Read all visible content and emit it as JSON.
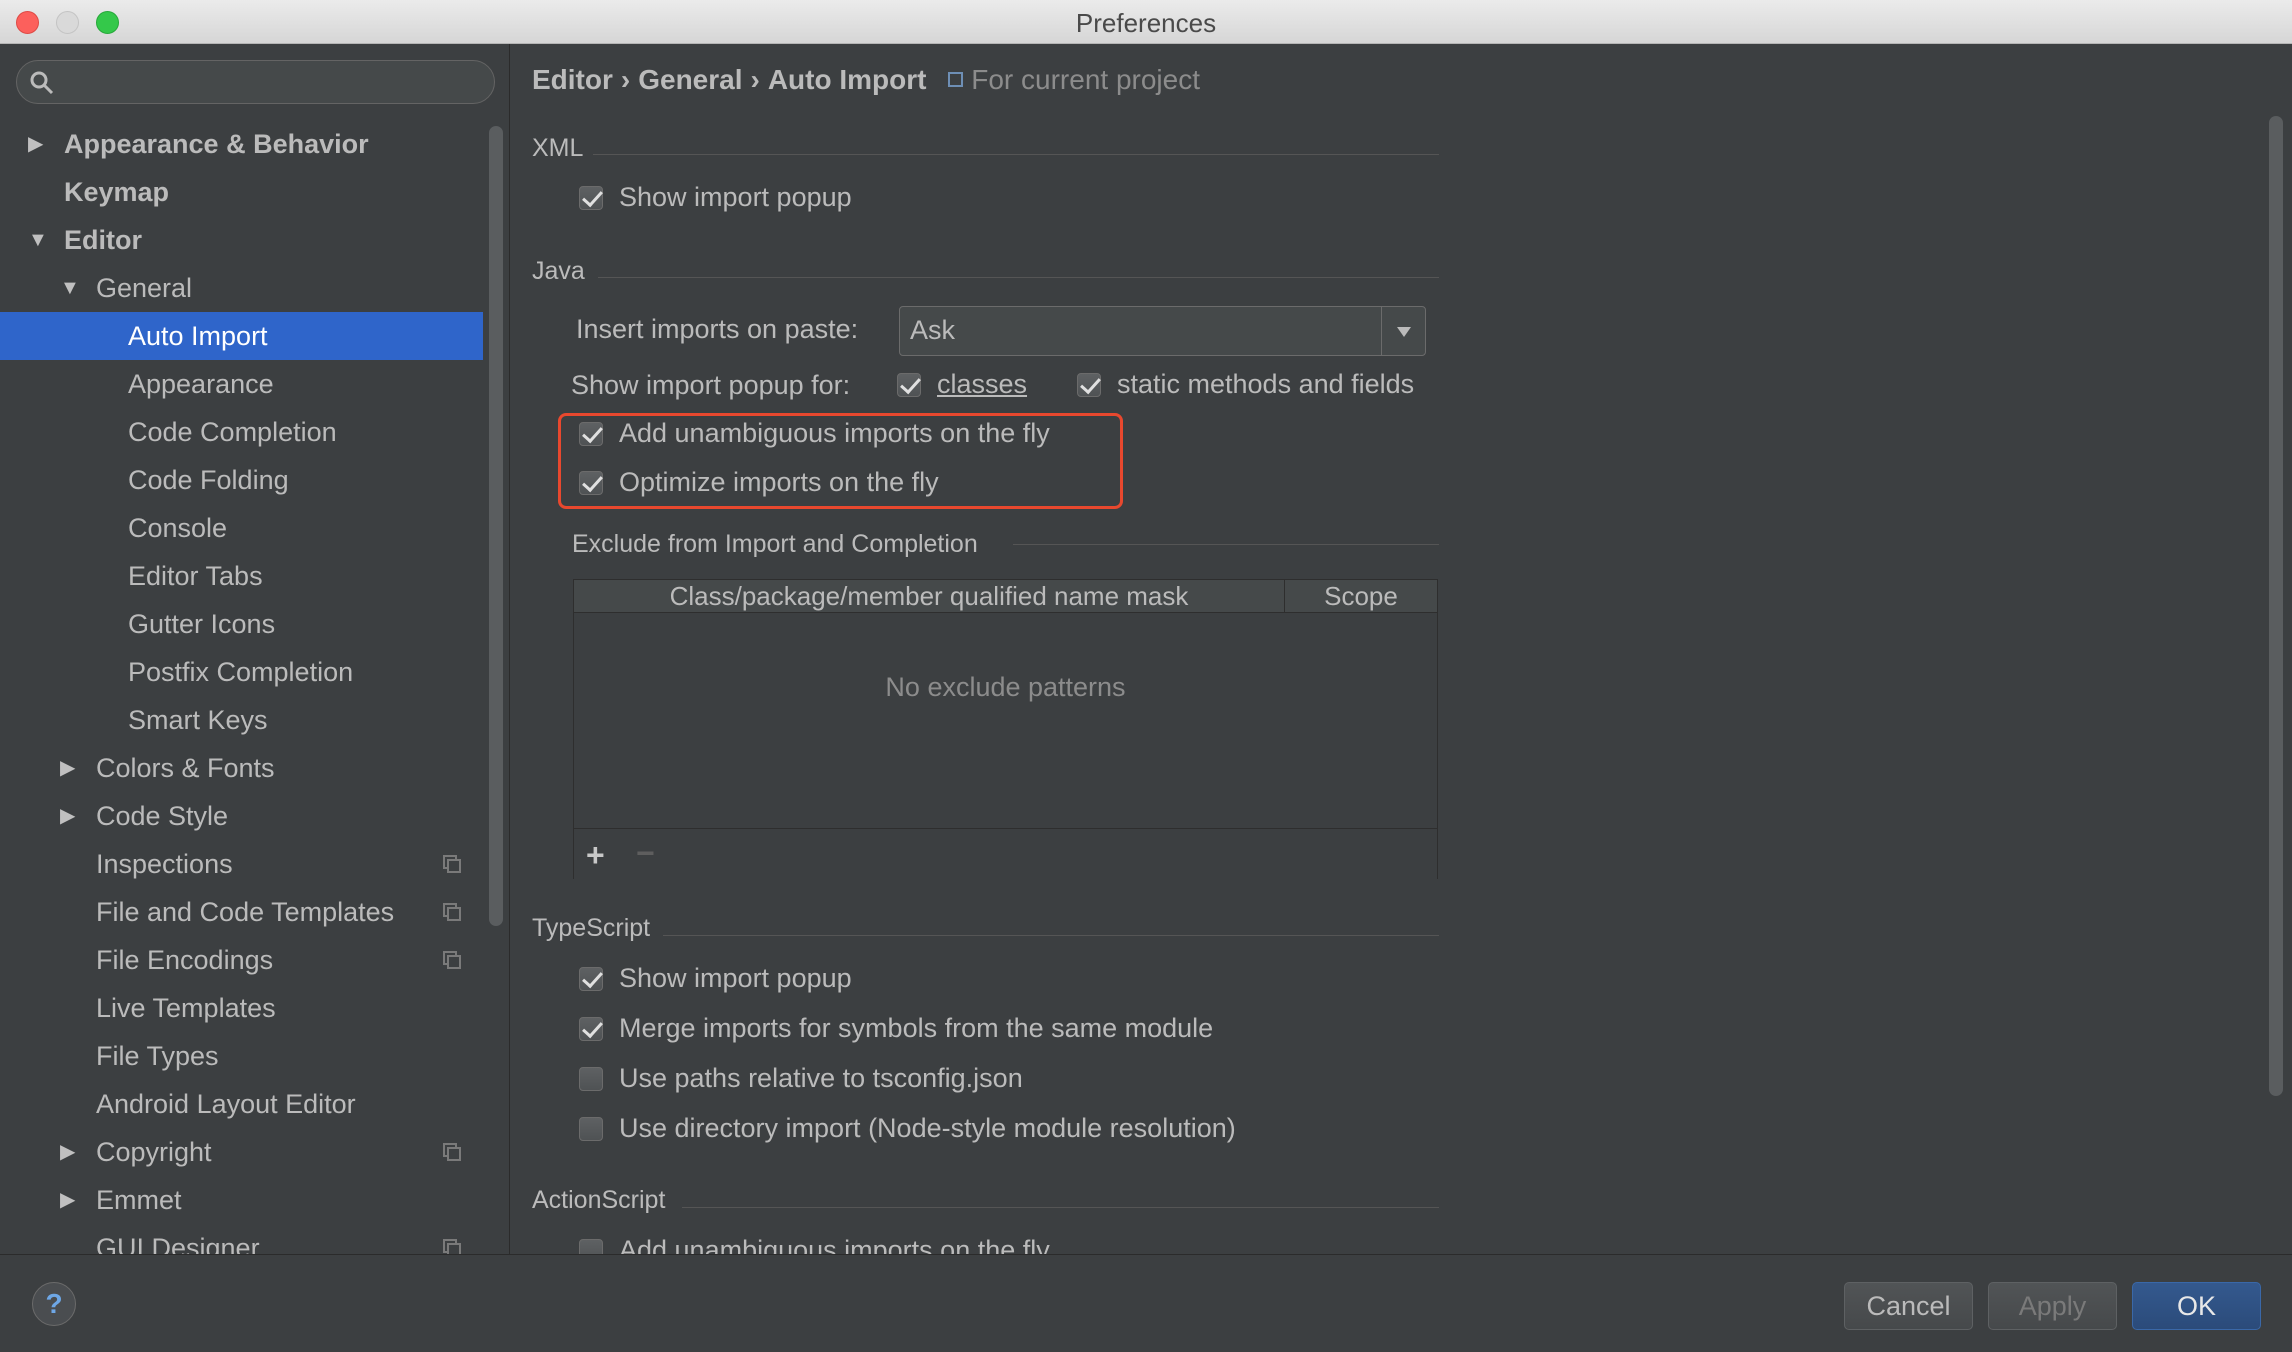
{
  "window": {
    "title": "Preferences"
  },
  "search": {
    "placeholder": ""
  },
  "sidebar": {
    "items": [
      {
        "label": "Appearance & Behavior",
        "arrow": "▶"
      },
      {
        "label": "Keymap"
      },
      {
        "label": "Editor",
        "arrow": "▼"
      },
      {
        "label": "General",
        "arrow": "▼"
      },
      {
        "label": "Auto Import"
      },
      {
        "label": "Appearance"
      },
      {
        "label": "Code Completion"
      },
      {
        "label": "Code Folding"
      },
      {
        "label": "Console"
      },
      {
        "label": "Editor Tabs"
      },
      {
        "label": "Gutter Icons"
      },
      {
        "label": "Postfix Completion"
      },
      {
        "label": "Smart Keys"
      },
      {
        "label": "Colors & Fonts",
        "arrow": "▶"
      },
      {
        "label": "Code Style",
        "arrow": "▶"
      },
      {
        "label": "Inspections"
      },
      {
        "label": "File and Code Templates"
      },
      {
        "label": "File Encodings"
      },
      {
        "label": "Live Templates"
      },
      {
        "label": "File Types"
      },
      {
        "label": "Android Layout Editor"
      },
      {
        "label": "Copyright",
        "arrow": "▶"
      },
      {
        "label": "Emmet",
        "arrow": "▶"
      },
      {
        "label": "GUI Designer"
      }
    ],
    "selected": "Auto Import"
  },
  "breadcrumb": {
    "parts": [
      "Editor",
      "General",
      "Auto Import"
    ],
    "separator": "›",
    "scope_note": "For current project"
  },
  "sections": {
    "xml": {
      "title": "XML",
      "show_import_popup": {
        "label": "Show import popup",
        "checked": true
      }
    },
    "java": {
      "title": "Java",
      "insert_on_paste_label": "Insert imports on paste:",
      "insert_on_paste_value": "Ask",
      "show_popup_for_label": "Show import popup for:",
      "classes": {
        "label": "classes",
        "checked": true
      },
      "static_methods": {
        "label": "static methods and fields",
        "checked": true
      },
      "add_unambiguous": {
        "label": "Add unambiguous imports on the fly",
        "checked": true
      },
      "optimize_imports": {
        "label": "Optimize imports on the fly",
        "checked": true
      },
      "exclude_title": "Exclude from Import and Completion",
      "table": {
        "col1": "Class/package/member qualified name mask",
        "col2": "Scope",
        "empty": "No exclude patterns",
        "add": "+",
        "remove": "−"
      }
    },
    "typescript": {
      "title": "TypeScript",
      "show_import_popup": {
        "label": "Show import popup",
        "checked": true
      },
      "merge_imports": {
        "label": "Merge imports for symbols from the same module",
        "checked": true
      },
      "relative_paths": {
        "label": "Use paths relative to tsconfig.json",
        "checked": false
      },
      "directory_import": {
        "label": "Use directory import (Node-style module resolution)",
        "checked": false
      }
    },
    "actionscript": {
      "title": "ActionScript",
      "add_unambiguous": {
        "label": "Add unambiguous imports on the fly",
        "checked": false
      }
    }
  },
  "buttons": {
    "help": "?",
    "cancel": "Cancel",
    "apply": "Apply",
    "ok": "OK"
  },
  "colors": {
    "selection": "#2f65ca",
    "highlight_box": "#e8482e",
    "background": "#3c3f41"
  }
}
